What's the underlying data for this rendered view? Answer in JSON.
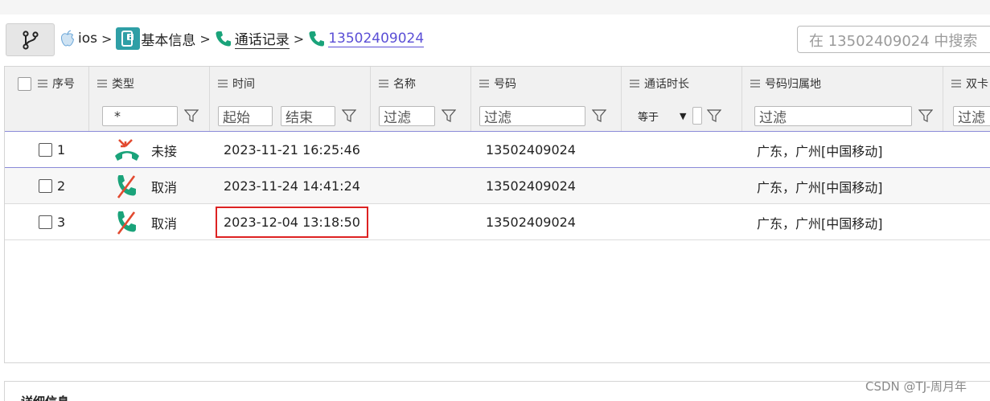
{
  "breadcrumb": {
    "items": [
      {
        "label": "ios",
        "icon": "apple-icon"
      },
      {
        "label": "基本信息",
        "icon": "device-info-icon"
      },
      {
        "label": "通话记录",
        "icon": "phone-icon"
      },
      {
        "label": "13502409024",
        "icon": "phone-icon"
      }
    ],
    "separator": ">"
  },
  "search": {
    "placeholder": "在 13502409024 中搜索"
  },
  "columns": [
    {
      "label": "序号"
    },
    {
      "label": "类型"
    },
    {
      "label": "时间"
    },
    {
      "label": "名称"
    },
    {
      "label": "号码"
    },
    {
      "label": "通话时长"
    },
    {
      "label": "号码归属地"
    },
    {
      "label": "双卡"
    }
  ],
  "filters": {
    "type": "*",
    "time_start": "起始",
    "time_end": "结束",
    "name": "过滤",
    "number": "过滤",
    "duration_op": "等于",
    "location": "过滤",
    "dual": "过滤"
  },
  "rows": [
    {
      "index": "1",
      "type": "未接",
      "type_icon": "missed-call-icon",
      "time": "2023-11-21 16:25:46",
      "number": "13502409024",
      "location": "广东，广州[中国移动]"
    },
    {
      "index": "2",
      "type": "取消",
      "type_icon": "cancelled-call-icon",
      "time": "2023-11-24 14:41:24",
      "number": "13502409024",
      "location": "广东，广州[中国移动]"
    },
    {
      "index": "3",
      "type": "取消",
      "type_icon": "cancelled-call-icon",
      "time": "2023-12-04 13:18:50",
      "number": "13502409024",
      "location": "广东，广州[中国移动]"
    }
  ],
  "detail": {
    "title": "详细信息"
  },
  "watermark": "CSDN @TJ-周月年",
  "colors": {
    "accent": "#5b4fd6",
    "call_green": "#1aa37a",
    "call_red": "#e2492f",
    "highlight": "#dd2222",
    "info_teal": "#2f9fa6"
  }
}
